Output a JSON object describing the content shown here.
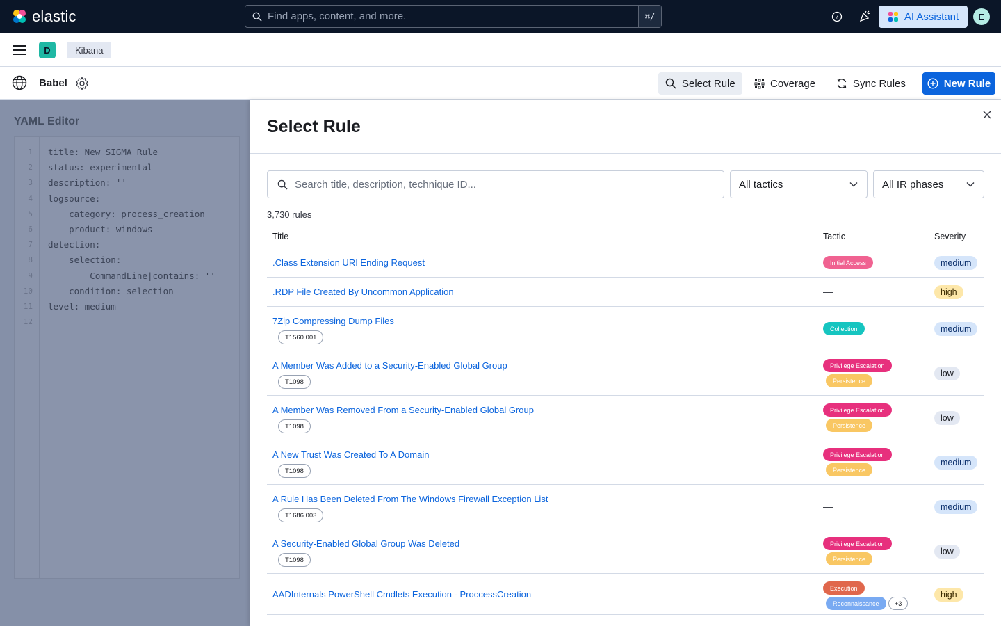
{
  "app": {
    "logo_text": "elastic"
  },
  "search": {
    "placeholder": "Find apps, content, and more.",
    "shortcut": "⌘/"
  },
  "header": {
    "ai_assistant_label": "AI Assistant",
    "avatar_initial": "E"
  },
  "breadcrumbs": {
    "space_initial": "D",
    "app_label": "Kibana"
  },
  "toolbar": {
    "page_title": "Babel",
    "select_rule_label": "Select Rule",
    "coverage_label": "Coverage",
    "sync_rules_label": "Sync Rules",
    "new_rule_label": "New Rule"
  },
  "editor": {
    "title": "YAML Editor",
    "line_numbers": [
      "1",
      "2",
      "3",
      "4",
      "5",
      "6",
      "7",
      "8",
      "9",
      "10",
      "11",
      "12"
    ],
    "lines": [
      "title: New SIGMA Rule",
      "status: experimental",
      "description: ''",
      "logsource:",
      "    category: process_creation",
      "    product: windows",
      "detection:",
      "    selection:",
      "        CommandLine|contains: ''",
      "    condition: selection",
      "level: medium",
      ""
    ]
  },
  "flyout": {
    "title": "Select Rule",
    "search_placeholder": "Search title, description, technique ID...",
    "tactic_filter": "All tactics",
    "phase_filter": "All IR phases",
    "rule_count": "3,730 rules",
    "columns": {
      "title": "Title",
      "tactic": "Tactic",
      "severity": "Severity"
    },
    "rows": [
      {
        "title": ".Class Extension URI Ending Request",
        "technique": "",
        "tactics": [
          "Initial Access"
        ],
        "more": "",
        "severity": "medium"
      },
      {
        "title": ".RDP File Created By Uncommon Application",
        "technique": "",
        "tactics": [],
        "more": "",
        "severity": "high"
      },
      {
        "title": "7Zip Compressing Dump Files",
        "technique": "T1560.001",
        "tactics": [
          "Collection"
        ],
        "more": "",
        "severity": "medium"
      },
      {
        "title": "A Member Was Added to a Security-Enabled Global Group",
        "technique": "T1098",
        "tactics": [
          "Privilege Escalation",
          "Persistence"
        ],
        "more": "",
        "severity": "low"
      },
      {
        "title": "A Member Was Removed From a Security-Enabled Global Group",
        "technique": "T1098",
        "tactics": [
          "Privilege Escalation",
          "Persistence"
        ],
        "more": "",
        "severity": "low"
      },
      {
        "title": "A New Trust Was Created To A Domain",
        "technique": "T1098",
        "tactics": [
          "Privilege Escalation",
          "Persistence"
        ],
        "more": "",
        "severity": "medium"
      },
      {
        "title": "A Rule Has Been Deleted From The Windows Firewall Exception List",
        "technique": "T1686.003",
        "tactics": [],
        "more": "",
        "severity": "medium"
      },
      {
        "title": "A Security-Enabled Global Group Was Deleted",
        "technique": "T1098",
        "tactics": [
          "Privilege Escalation",
          "Persistence"
        ],
        "more": "",
        "severity": "low"
      },
      {
        "title": "AADInternals PowerShell Cmdlets Execution - ProccessCreation",
        "technique": "",
        "tactics": [
          "Execution",
          "Reconnaissance"
        ],
        "more": "+3",
        "severity": "high"
      }
    ],
    "empty_tactic": "—"
  },
  "colors": {
    "topbar_bg": "#0b1628",
    "primary": "#0b64dd",
    "tactic_initial_access": "#f06291",
    "tactic_collection": "#16c5c0",
    "tactic_privilege_escalation": "#e7307d",
    "tactic_persistence": "#f9c763",
    "tactic_execution": "#e0674c",
    "tactic_reconnaissance": "#79aaf2"
  },
  "icons": {
    "search": "search-icon",
    "help": "help-icon",
    "news": "newsfeed-icon",
    "ai": "ai-assistant-icon",
    "menu": "hamburger-menu-icon",
    "globe": "globe-icon",
    "settings": "gear-icon",
    "coverage": "grid-icon",
    "sync": "refresh-icon",
    "add": "plus-circle-icon",
    "close": "close-icon",
    "chevron": "chevron-down-icon"
  }
}
